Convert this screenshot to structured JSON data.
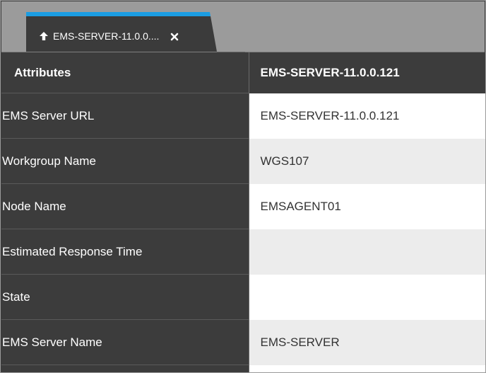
{
  "tab": {
    "label": "EMS-SERVER-11.0.0....",
    "icon": "arrow-up-icon",
    "close_icon": "close-x-icon",
    "accent_color": "#1b9de2"
  },
  "table": {
    "headers": {
      "attributes": "Attributes",
      "server": "EMS-SERVER-11.0.0.121"
    },
    "rows": [
      {
        "name": "EMS Server URL",
        "value": "EMS-SERVER-11.0.0.121"
      },
      {
        "name": "Workgroup Name",
        "value": "WGS107"
      },
      {
        "name": "Node Name",
        "value": "EMSAGENT01"
      },
      {
        "name": "Estimated Response Time",
        "value": ""
      },
      {
        "name": "State",
        "value": ""
      },
      {
        "name": "EMS Server Name",
        "value": "EMS-SERVER"
      }
    ]
  }
}
